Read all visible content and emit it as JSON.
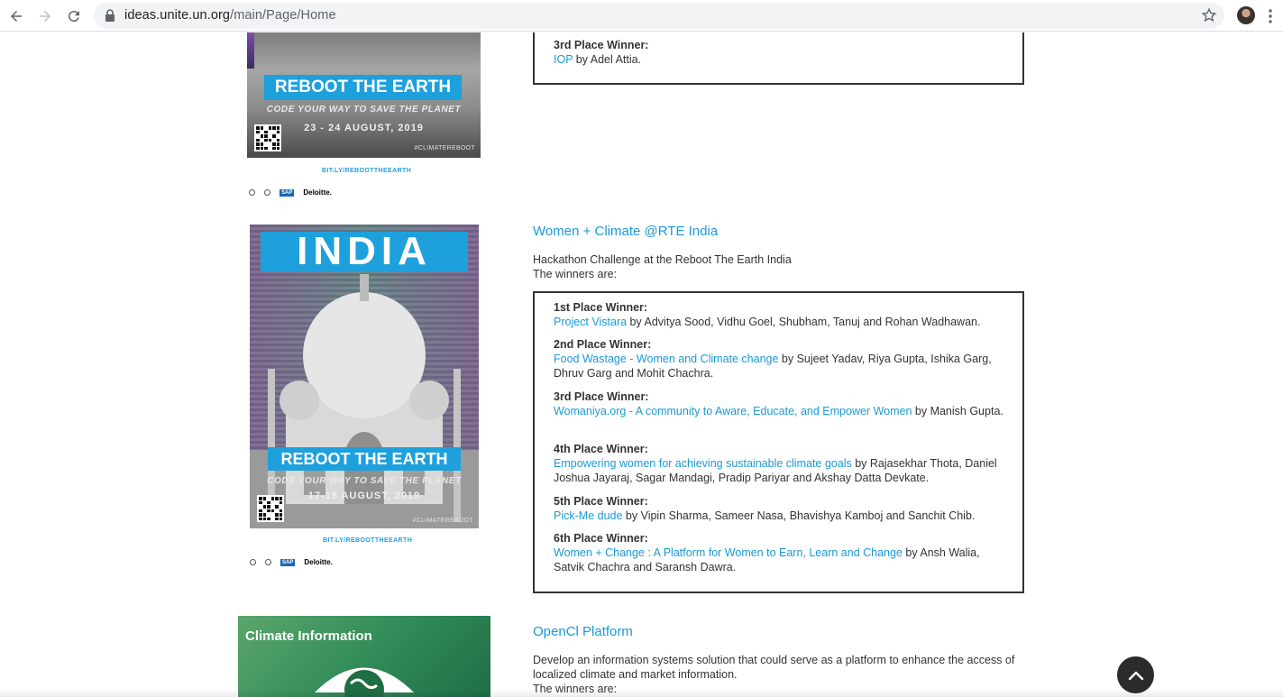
{
  "browser": {
    "url_host": "ideas.unite.un.org",
    "url_path": "/main/Page/Home"
  },
  "poster_top": {
    "banner": "REBOOT THE EARTH",
    "subtitle": "CODE YOUR WAY TO SAVE THE PLANET",
    "date": "23 - 24 AUGUST, 2019",
    "hashtag": "#CLIMATEREBOOT",
    "link": "BIT.LY/REBOOTTHEEARTH",
    "logo_deloitte": "Deloitte.",
    "logo_sap": "SAP"
  },
  "section_prev": {
    "winners": [
      {
        "place": "3rd Place Winner:",
        "link": "IOP",
        "rest": " by Adel Attia."
      }
    ]
  },
  "poster_india": {
    "headline": "INDIA",
    "banner": "REBOOT THE EARTH",
    "subtitle": "CODE YOUR WAY TO SAVE THE PLANET",
    "date": "17-18 AUGUST, 2019",
    "hashtag": "#CLIMATEREBOOT",
    "link": "BIT.LY/REBOOTTHEEARTH",
    "logo_deloitte": "Deloitte.",
    "logo_sap": "SAP"
  },
  "section_india": {
    "title": "Women + Climate @RTE India",
    "desc_line1": "Hackathon Challenge at the Reboot The Earth India",
    "desc_line2": "The winners are:",
    "winners": [
      {
        "place": "1st Place Winner:",
        "link": "Project Vistara",
        "rest": " by Advitya Sood, Vidhu Goel, Shubham, Tanuj and Rohan Wadhawan."
      },
      {
        "place": "2nd Place Winner:",
        "link": "Food Wastage - Women and Climate change",
        "rest": " by Sujeet Yadav, Riya Gupta, Ishika Garg, Dhruv Garg and Mohit Chachra."
      },
      {
        "place": "3rd Place Winner:",
        "link": "Womaniya.org - A community to Aware, Educate, and Empower Women",
        "rest": " by Manish Gupta."
      },
      {
        "place": "4th Place Winner:",
        "link": "Empowering women for achieving sustainable climate goals",
        "rest": " by Rajasekhar Thota, Daniel Joshua Jayaraj, Sagar Mandagi, Pradip Pariyar and Akshay Datta Devkate."
      },
      {
        "place": "5th Place Winner:",
        "link": "Pick-Me dude",
        "rest": " by Vipin Sharma, Sameer Nasa, Bhavishya Kamboj and Sanchit Chib."
      },
      {
        "place": "6th Place Winner:",
        "link": "Women + Change : A Platform for Women to Earn, Learn and Change",
        "rest": " by Ansh Walia, Satvik Chachra and Saransh Dawra."
      }
    ]
  },
  "poster_opencl": {
    "title": "Climate Information"
  },
  "section_opencl": {
    "title": "OpenCl Platform",
    "desc": "Develop an information systems solution that could serve as a platform to enhance the access of localized climate and market information.",
    "desc_line2": "The winners are:"
  },
  "colors": {
    "link": "#1a9ad6",
    "banner": "#1ea0dc",
    "scroll_button": "#2b2b2b"
  },
  "icons": [
    "back-arrow-icon",
    "forward-arrow-icon",
    "reload-icon",
    "lock-icon",
    "star-icon",
    "kebab-menu-icon",
    "chevron-up-icon",
    "globe-icon",
    "eye-icon"
  ]
}
